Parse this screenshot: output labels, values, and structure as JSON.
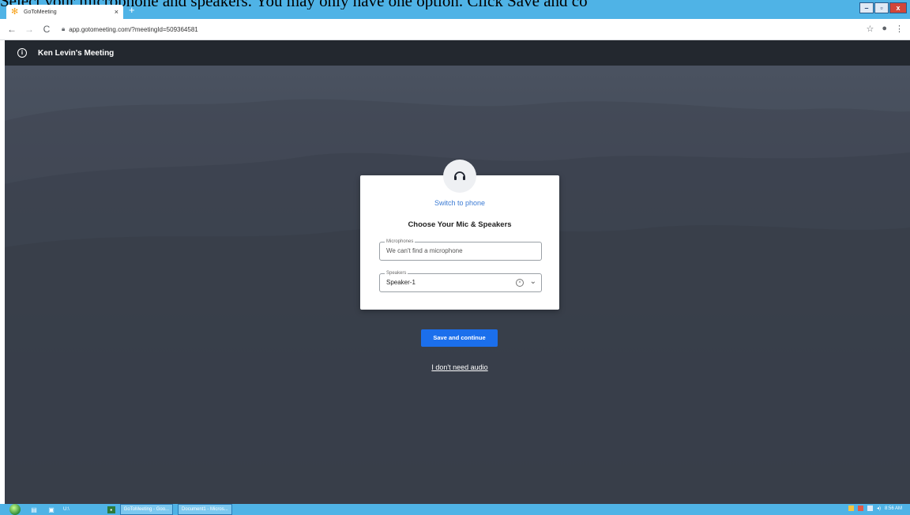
{
  "caption": "Select your microphone and speakers. You may only have one option. Click Save and co",
  "browser": {
    "tab_title": "GoToMeeting",
    "tab_close": "×",
    "new_tab": "+",
    "url": "app.gotomeeting.com/?meetingId=509364581",
    "window_controls": {
      "minimize": "–",
      "maximize": "▫",
      "close": "x"
    }
  },
  "app": {
    "meeting_title": "Ken Levin's Meeting",
    "switch_to_phone": "Switch to phone",
    "card_title": "Choose Your Mic & Speakers",
    "microphones_label": "Microphones",
    "microphones_value": "We can't find a microphone",
    "speakers_label": "Speakers",
    "speakers_value": "Speaker-1",
    "save_button": "Save and continue",
    "no_audio_link": "I don't need audio"
  },
  "taskbar": {
    "items": [
      "U:\\",
      "GoToMeeting - Goo...",
      "Document1 - Micros..."
    ],
    "clock": "8:56 AM"
  },
  "colors": {
    "accent": "#1b6fec",
    "link": "#3b7bd4",
    "header": "#23282f",
    "taskbar": "#4fb3e6"
  }
}
